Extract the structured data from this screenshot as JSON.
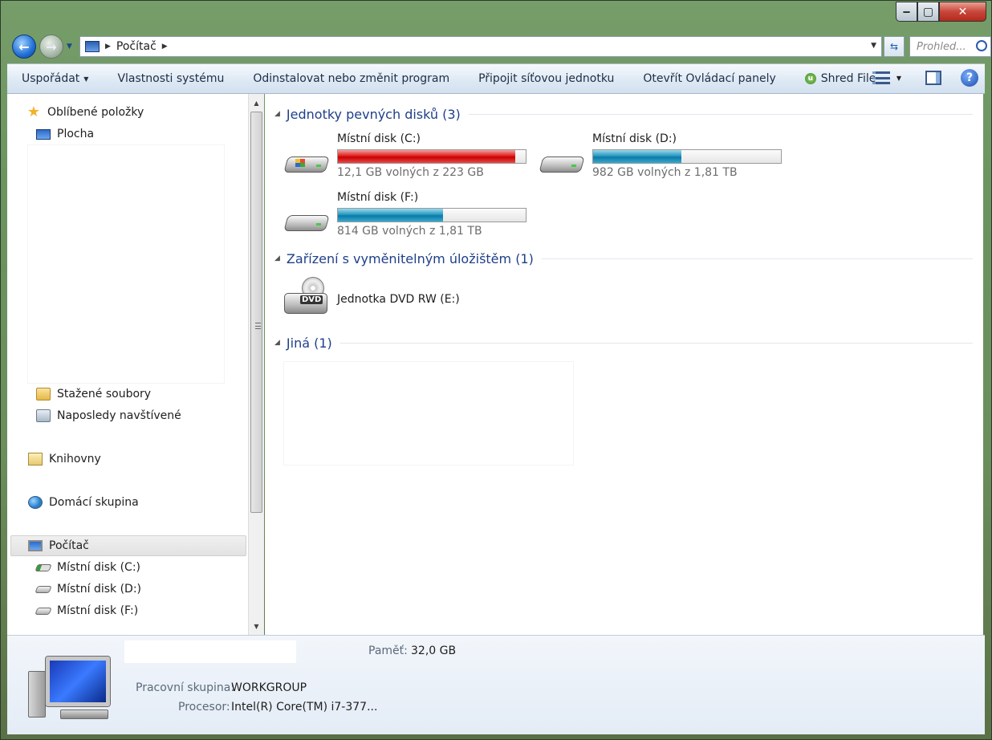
{
  "window": {
    "caption_buttons": {
      "minimize": "‒",
      "maximize": "▢",
      "close": "✕"
    }
  },
  "address": {
    "breadcrumb": "Počítač",
    "search_placeholder": "Prohled..."
  },
  "toolbar": {
    "organize": "Uspořádat",
    "system_properties": "Vlastnosti systému",
    "uninstall": "Odinstalovat nebo změnit program",
    "map_drive": "Připojit síťovou jednotku",
    "control_panel": "Otevřít Ovládací panely",
    "shred_file": "Shred File",
    "help": "?"
  },
  "navpane": {
    "favorites": "Oblíbené položky",
    "desktop": "Plocha",
    "downloads": "Stažené soubory",
    "recent": "Naposledy navštívené",
    "libraries": "Knihovny",
    "homegroup": "Domácí skupina",
    "computer": "Počítač",
    "drive_c": "Místní disk (C:)",
    "drive_d": "Místní disk (D:)",
    "drive_f": "Místní disk (F:)"
  },
  "groups": {
    "hard_disks": "Jednotky pevných disků (3)",
    "removable": "Zařízení s vyměnitelným úložištěm (1)",
    "other": "Jiná (1)"
  },
  "drives": [
    {
      "name": "Místní disk (C:)",
      "free": "12,1 GB volných z 223 GB",
      "used_fraction": 0.946,
      "color": "#d40000"
    },
    {
      "name": "Místní disk (D:)",
      "free": "982 GB volných z 1,81 TB",
      "used_fraction": 0.47,
      "color": "#1a8ab8"
    },
    {
      "name": "Místní disk (F:)",
      "free": "814 GB volných z 1,81 TB",
      "used_fraction": 0.56,
      "color": "#1a8ab8"
    }
  ],
  "dvd": {
    "name": "Jednotka DVD RW (E:)",
    "badge": "DVD"
  },
  "details": {
    "memory_label": "Paměť:",
    "memory_value": "32,0 GB",
    "workgroup_label": "Pracovní skupina:",
    "workgroup_value": "WORKGROUP",
    "cpu_label": "Procesor:",
    "cpu_value": "Intel(R) Core(TM) i7-377..."
  }
}
